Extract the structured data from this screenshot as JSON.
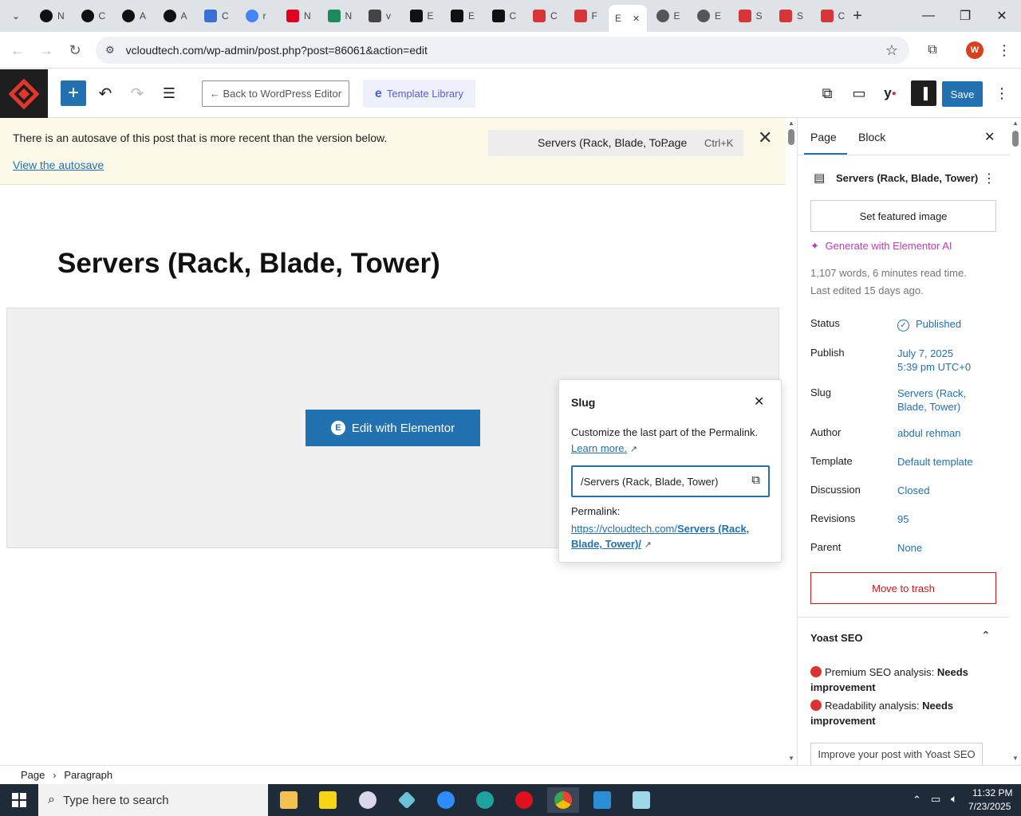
{
  "browser": {
    "tabs": [
      {
        "title": "N",
        "favicon": "openai-icon",
        "color": "#111111"
      },
      {
        "title": "C",
        "favicon": "openai-icon",
        "color": "#111111"
      },
      {
        "title": "A",
        "favicon": "openai-icon",
        "color": "#111111"
      },
      {
        "title": "A",
        "favicon": "openai-icon",
        "color": "#111111"
      },
      {
        "title": "C",
        "favicon": "perplexity-icon",
        "color": "#3b6fd4"
      },
      {
        "title": "r",
        "favicon": "google-icon",
        "color": "#4285f4"
      },
      {
        "title": "N",
        "favicon": "youtube-icon",
        "color": "#e00020"
      },
      {
        "title": "N",
        "favicon": "wordpress-w-icon",
        "color": "#1d8a5a"
      },
      {
        "title": "v",
        "favicon": "linkedin-icon",
        "color": "#444444"
      },
      {
        "title": "E",
        "favicon": "x-icon",
        "color": "#111111"
      },
      {
        "title": "E",
        "favicon": "x-icon",
        "color": "#111111"
      },
      {
        "title": "C",
        "favicon": "spark-icon",
        "color": "#111111"
      },
      {
        "title": "C",
        "favicon": "red-diamond-icon",
        "color": "#d63638"
      },
      {
        "title": "F",
        "favicon": "red-diamond-icon",
        "color": "#d63638"
      },
      {
        "title": "E",
        "favicon": "",
        "color": "#ffffff",
        "active": true
      },
      {
        "title": "E",
        "favicon": "globe-icon",
        "color": "#555555"
      },
      {
        "title": "E",
        "favicon": "globe-icon",
        "color": "#555555"
      },
      {
        "title": "S",
        "favicon": "red-diamond-icon",
        "color": "#d63638"
      },
      {
        "title": "S",
        "favicon": "red-diamond-icon",
        "color": "#d63638"
      },
      {
        "title": "C",
        "favicon": "red-diamond-icon",
        "color": "#d63638"
      }
    ],
    "url": "vcloudtech.com/wp-admin/post.php?post=86061&action=edit",
    "profile_initial": "W"
  },
  "wp_header": {
    "back_label": "← Back to WordPress Editor",
    "template_library_label": "Template Library",
    "save_label": "Save"
  },
  "notice": {
    "text": "There is an autosave of this post that is more recent than the version below.",
    "link": "View the autosave"
  },
  "command_bar": {
    "title": "Servers (Rack, Blade, To...",
    "type": "· Page",
    "shortcut": "Ctrl+K"
  },
  "page_title": "Servers (Rack, Blade, Tower)",
  "edit_elementor_label": "Edit with Elementor",
  "slug_popover": {
    "heading": "Slug",
    "description": "Customize the last part of the Permalink.",
    "learn_more": "Learn more.",
    "input_value": "/Servers (Rack, Blade, Tower)",
    "permalink_label": "Permalink:",
    "permalink_base": "https://vcloudtech.com/",
    "permalink_slug": "Servers (Rack, Blade, Tower)/"
  },
  "sidebar": {
    "tabs": [
      "Page",
      "Block"
    ],
    "page_title": "Servers (Rack, Blade, Tower)",
    "featured_image": "Set featured image",
    "elementor_ai": "Generate with Elementor AI",
    "stats_line1": "1,107 words, 6 minutes read time.",
    "stats_line2": "Last edited 15 days ago.",
    "rows": [
      {
        "label": "Status",
        "value": "Published"
      },
      {
        "label": "Publish",
        "value": "July 7, 2025",
        "value2": "5:39 pm UTC+0"
      },
      {
        "label": "Slug",
        "value": "Servers (Rack,",
        "value2": "Blade, Tower)"
      },
      {
        "label": "Author",
        "value": "abdul rehman"
      },
      {
        "label": "Template",
        "value": "Default template"
      },
      {
        "label": "Discussion",
        "value": "Closed"
      },
      {
        "label": "Revisions",
        "value": "95"
      },
      {
        "label": "Parent",
        "value": "None"
      }
    ],
    "trash": "Move to trash",
    "yoast_heading": "Yoast SEO",
    "seo_label": "Premium SEO analysis:",
    "seo_value": "Needs improvement",
    "read_label": "Readability analysis:",
    "read_value": "Needs improvement",
    "improve_btn": "Improve your post with Yoast SEO"
  },
  "breadcrumb": [
    "Page",
    "Paragraph"
  ],
  "taskbar": {
    "search_placeholder": "Type here to search",
    "time": "11:32 PM",
    "date": "7/23/2025"
  }
}
